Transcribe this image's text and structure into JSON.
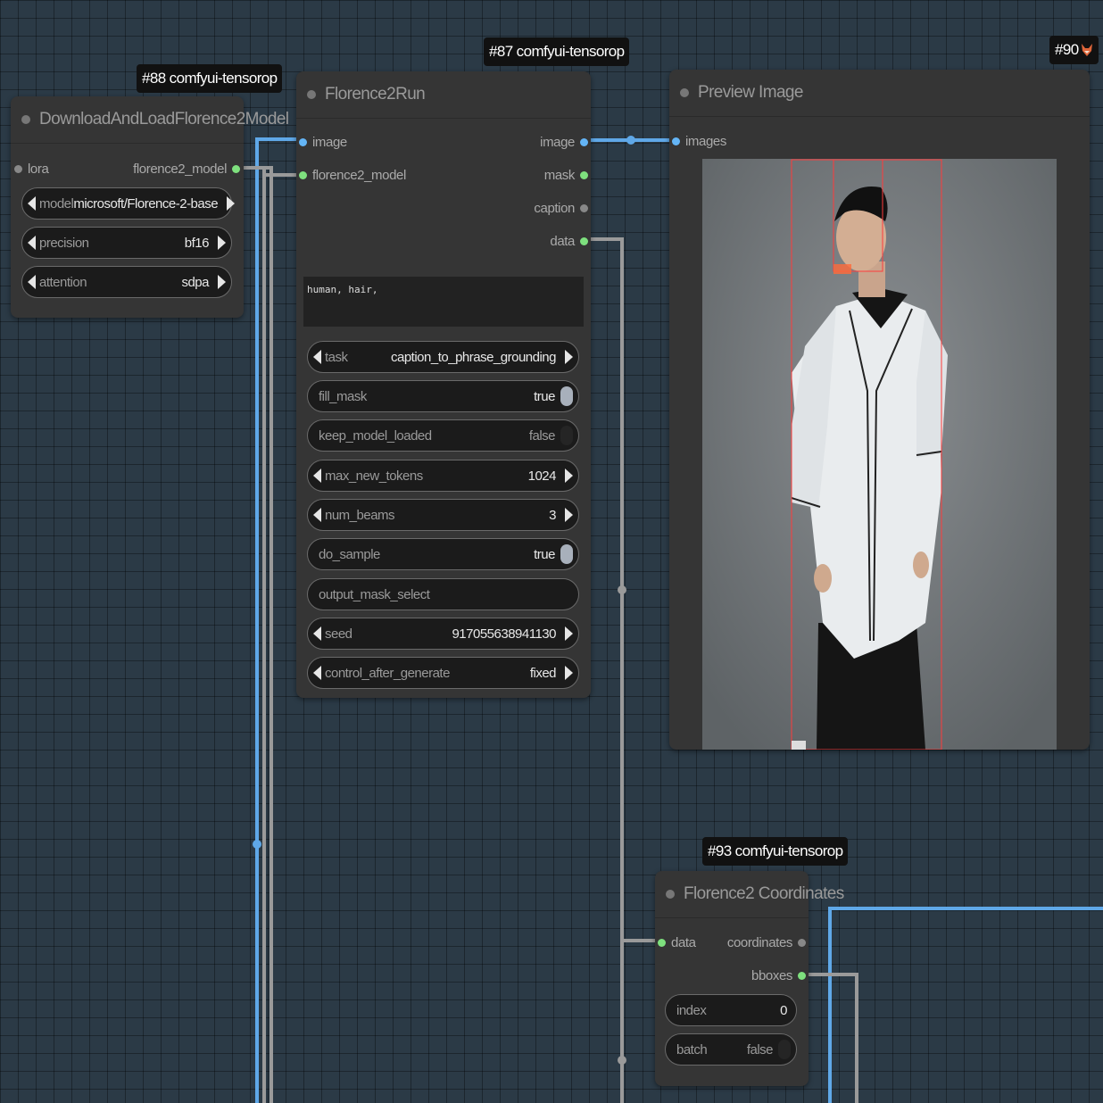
{
  "nodes": {
    "download": {
      "badge": "#88 comfyui-tensorop",
      "title": "DownloadAndLoadFlorence2Model",
      "inputs": {
        "lora": "lora"
      },
      "outputs": {
        "florence2_model": "florence2_model"
      },
      "widgets": {
        "model": {
          "label": "model",
          "value": "microsoft/Florence-2-base"
        },
        "precision": {
          "label": "precision",
          "value": "bf16"
        },
        "attention": {
          "label": "attention",
          "value": "sdpa"
        }
      }
    },
    "run": {
      "badge": "#87 comfyui-tensorop",
      "title": "Florence2Run",
      "inputs": {
        "image": "image",
        "florence2_model": "florence2_model"
      },
      "outputs": {
        "image": "image",
        "mask": "mask",
        "caption": "caption",
        "data": "data"
      },
      "text_input": "human, hair,",
      "widgets": {
        "task": {
          "label": "task",
          "value": "caption_to_phrase_grounding"
        },
        "fill_mask": {
          "label": "fill_mask",
          "value": "true"
        },
        "keep_model_loaded": {
          "label": "keep_model_loaded",
          "value": "false"
        },
        "max_new_tokens": {
          "label": "max_new_tokens",
          "value": "1024"
        },
        "num_beams": {
          "label": "num_beams",
          "value": "3"
        },
        "do_sample": {
          "label": "do_sample",
          "value": "true"
        },
        "output_mask_select": {
          "label": "output_mask_select",
          "value": ""
        },
        "seed": {
          "label": "seed",
          "value": "917055638941130"
        },
        "control_after_generate": {
          "label": "control_after_generate",
          "value": "fixed"
        }
      }
    },
    "preview": {
      "badge": "#90",
      "title": "Preview Image",
      "inputs": {
        "images": "images"
      }
    },
    "coords": {
      "badge": "#93 comfyui-tensorop",
      "title": "Florence2 Coordinates",
      "inputs": {
        "data": "data"
      },
      "outputs": {
        "coordinates": "coordinates",
        "bboxes": "bboxes"
      },
      "widgets": {
        "index": {
          "label": "index",
          "value": "0"
        },
        "batch": {
          "label": "batch",
          "value": "false"
        }
      }
    }
  },
  "colors": {
    "canvas": "#2b3a46",
    "node_bg": "#353535",
    "image_link": "#64b5f6",
    "model_link": "#a0a0a0",
    "accent_green": "#7ee07e"
  },
  "icons": [
    "fox-icon",
    "node-status-dot"
  ]
}
